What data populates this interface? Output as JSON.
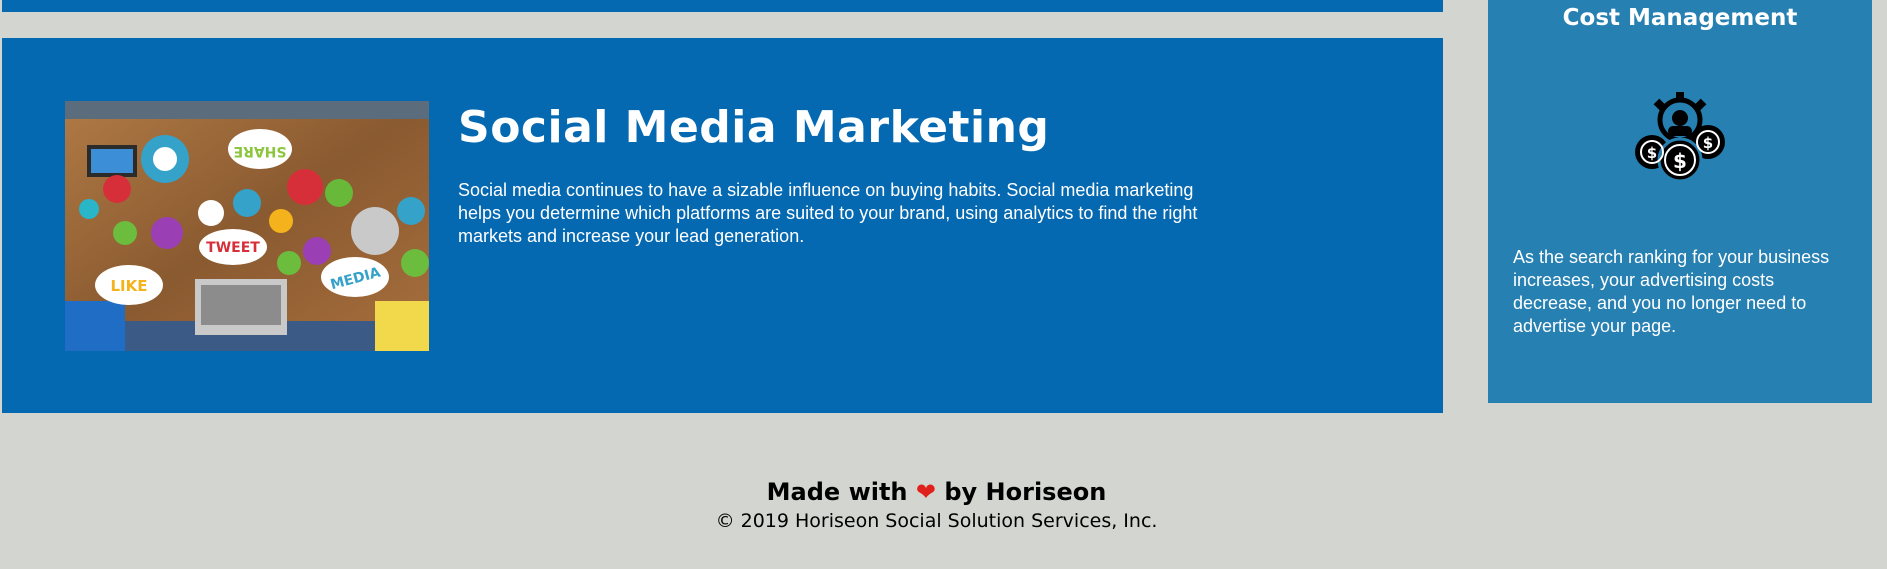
{
  "main_section": {
    "title": "Social Media Marketing",
    "body": "Social media continues to have a sizable influence on buying habits. Social media marketing helps you determine which platforms are suited to your brand, using analytics to find the right markets and increase your lead generation.",
    "image_icon": "social-media-collage-image"
  },
  "sidebar": {
    "title": "Cost Management",
    "icon": "cost-management-icon",
    "body": "As the search ranking for your business increases, your advertising costs decrease, and you no longer need to advertise your page."
  },
  "footer": {
    "made_with": "Made with",
    "heart": "❤",
    "by": "by Horiseon",
    "copyright": "© 2019 Horiseon Social Solution Services, Inc."
  },
  "collage_labels": {
    "share": "SHARE",
    "tweet": "TWEET",
    "like": "LIKE",
    "media": "MEDIA"
  },
  "colors": {
    "section_blue": "#0569b2",
    "sidebar_blue": "#2780b2",
    "page_bg": "#d3d5d0",
    "heart_red": "#e0201b"
  }
}
